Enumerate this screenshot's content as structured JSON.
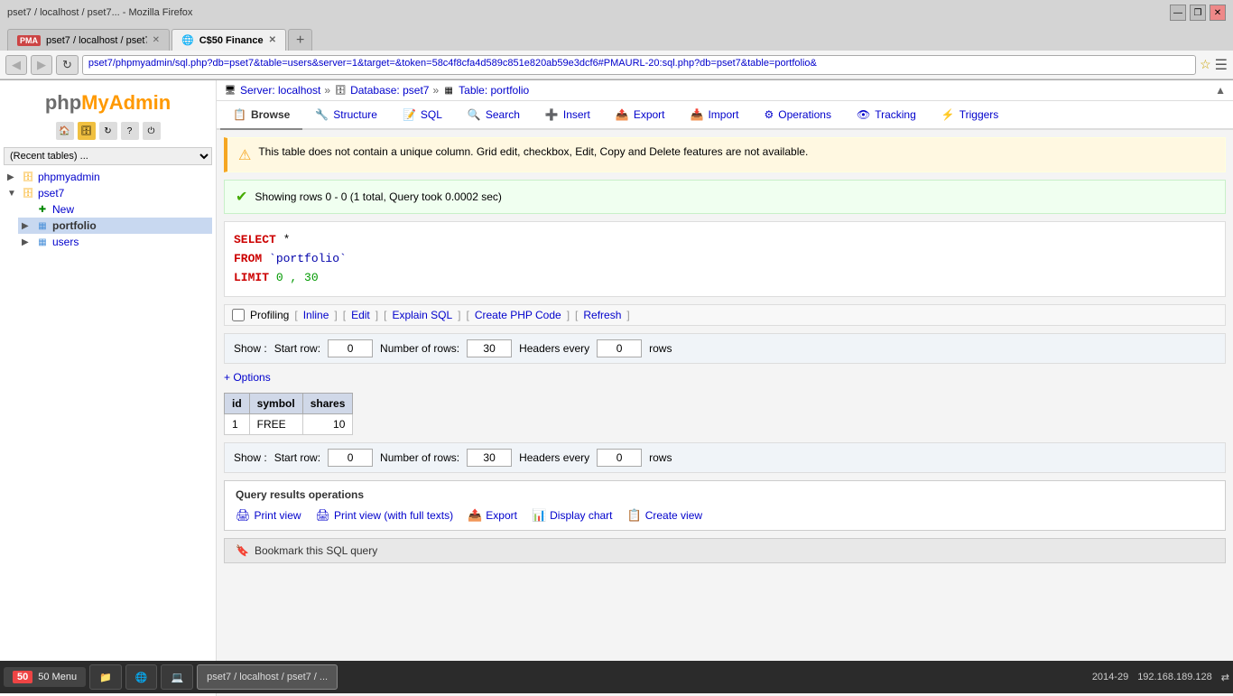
{
  "browser": {
    "tabs": [
      {
        "label": "pset7 / localhost / pset7...",
        "active": false,
        "favicon": "PMA"
      },
      {
        "label": "C$50 Finance",
        "active": true,
        "favicon": "🌐"
      },
      {
        "label": "new-tab",
        "active": false,
        "favicon": ""
      }
    ],
    "address": "pset7/phpmyadmin/sql.php?db=pset7&table=users&server=1&target=&token=58c4f8cfa4d589c851e820ab59e3dcf6#PMAURL-20:sql.php?db=pset7&table=portfolio&",
    "back_btn": "◀",
    "forward_btn": "▶",
    "refresh_btn": "↻"
  },
  "breadcrumb": {
    "server_label": "Server: localhost",
    "db_label": "Database: pset7",
    "table_label": "Table: portfolio"
  },
  "tabs": {
    "items": [
      {
        "label": "Browse",
        "icon": "📋",
        "active": true
      },
      {
        "label": "Structure",
        "icon": "🔧"
      },
      {
        "label": "SQL",
        "icon": "📝"
      },
      {
        "label": "Search",
        "icon": "🔍"
      },
      {
        "label": "Insert",
        "icon": "➕"
      },
      {
        "label": "Export",
        "icon": "📤"
      },
      {
        "label": "Import",
        "icon": "📥"
      },
      {
        "label": "Operations",
        "icon": "⚙"
      },
      {
        "label": "Tracking",
        "icon": "👁"
      },
      {
        "label": "Triggers",
        "icon": "⚡"
      }
    ]
  },
  "alerts": {
    "warning": "This table does not contain a unique column. Grid edit, checkbox, Edit, Copy and Delete features are not available.",
    "success": "Showing rows 0 - 0 (1 total, Query took 0.0002 sec)"
  },
  "sql": {
    "select": "SELECT",
    "star": " *",
    "from": "FROM",
    "table": " `portfolio`",
    "limit": "LIMIT",
    "range": " 0 , 30"
  },
  "profiling": {
    "label": "Profiling",
    "inline": "Inline",
    "edit": "Edit",
    "explain_sql": "Explain SQL",
    "create_php": "Create PHP Code",
    "refresh": "Refresh"
  },
  "show_bar": {
    "label": "Show :",
    "start_row_label": "Start row:",
    "start_row_value": "0",
    "num_rows_label": "Number of rows:",
    "num_rows_value": "30",
    "headers_label": "Headers every",
    "headers_value": "0",
    "rows_label": "rows"
  },
  "options_link": "+ Options",
  "table": {
    "headers": [
      "id",
      "symbol",
      "shares"
    ],
    "rows": [
      {
        "id": "1",
        "symbol": "FREE",
        "shares": "10"
      }
    ]
  },
  "show_bar2": {
    "label": "Show :",
    "start_row_label": "Start row:",
    "start_row_value": "0",
    "num_rows_label": "Number of rows:",
    "num_rows_value": "30",
    "headers_label": "Headers every",
    "headers_value": "0",
    "rows_label": "rows"
  },
  "query_results": {
    "title": "Query results operations",
    "operations": [
      {
        "label": "Print view",
        "icon": "🖨"
      },
      {
        "label": "Print view (with full texts)",
        "icon": "🖨"
      },
      {
        "label": "Export",
        "icon": "📤"
      },
      {
        "label": "Display chart",
        "icon": "📊"
      },
      {
        "label": "Create view",
        "icon": "📋"
      }
    ]
  },
  "bookmark": {
    "label": "Bookmark this SQL query",
    "icon": "🔖"
  },
  "sidebar": {
    "logo_php": "php",
    "logo_admin": "MyAdmin",
    "recent_placeholder": "(Recent tables) ...",
    "tree": {
      "phpmyadmin": {
        "label": "phpmyadmin",
        "expanded": false
      },
      "pset7": {
        "label": "pset7",
        "expanded": true,
        "children": [
          {
            "label": "New",
            "type": "new"
          },
          {
            "label": "portfolio",
            "type": "table",
            "selected": true
          },
          {
            "label": "users",
            "type": "table"
          }
        ]
      }
    }
  },
  "taskbar": {
    "start_label": "50 Menu",
    "items": [
      {
        "label": "",
        "icon": "🖥",
        "active": false
      },
      {
        "label": "",
        "icon": "🌐",
        "active": false
      },
      {
        "label": "",
        "icon": "💻",
        "active": false
      },
      {
        "label": "pset7 / localhost / pset7 / ...",
        "icon": "",
        "active": true
      }
    ],
    "time": "2014-29",
    "ip": "192.168.189.128",
    "sync_icon": "⇄"
  }
}
